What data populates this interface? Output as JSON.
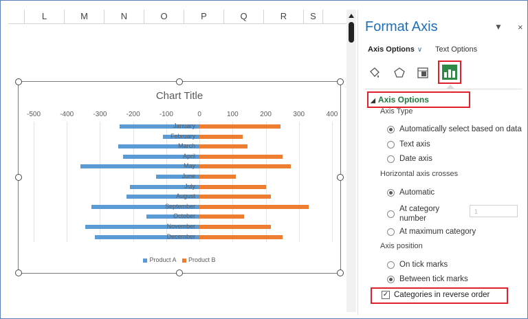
{
  "columns": [
    "L",
    "M",
    "N",
    "O",
    "P",
    "Q",
    "R",
    "S"
  ],
  "chart_data": {
    "type": "bar",
    "title": "Chart Title",
    "categories": [
      "January",
      "February",
      "March",
      "April",
      "May",
      "June",
      "July",
      "August",
      "September",
      "October",
      "November",
      "December"
    ],
    "series": [
      {
        "name": "Product A",
        "color": "#5b9bd5",
        "values": [
          -240,
          -110,
          -245,
          -230,
          -360,
          -130,
          -210,
          -220,
          -325,
          -160,
          -345,
          -315
        ]
      },
      {
        "name": "Product B",
        "color": "#ed7d31",
        "values": [
          245,
          130,
          145,
          250,
          275,
          110,
          200,
          215,
          330,
          135,
          215,
          250
        ]
      }
    ],
    "x_ticks": [
      "-500",
      "-400",
      "-300",
      "-200",
      "-100",
      "0",
      "100",
      "200",
      "300",
      "400"
    ],
    "xlim": [
      -500,
      400
    ],
    "orientation": "horizontal",
    "legend_position": "bottom"
  },
  "pane": {
    "title": "Format Axis",
    "tabs": {
      "axis_options": "Axis Options",
      "text_options": "Text Options"
    },
    "icons": [
      "fill-line-icon",
      "effects-icon",
      "size-properties-icon",
      "axis-options-icon"
    ],
    "section": "Axis Options",
    "axis_type_label": "Axis Type",
    "axis_type_options": [
      "Automatically select based on data",
      "Text axis",
      "Date axis"
    ],
    "crosses_label": "Horizontal axis crosses",
    "crosses_options": [
      "Automatic",
      "At category number",
      "At maximum category"
    ],
    "crosses_value": "1",
    "position_label": "Axis position",
    "position_options": [
      "On tick marks",
      "Between tick marks"
    ],
    "reverse_label": "Categories in reverse order"
  }
}
